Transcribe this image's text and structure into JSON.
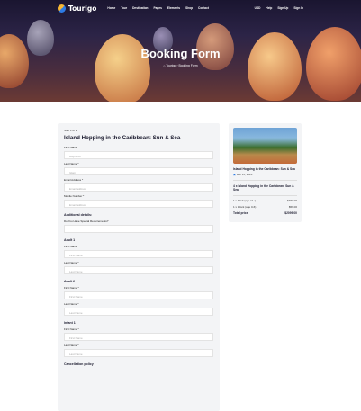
{
  "brand": {
    "name": "Tourigo"
  },
  "nav": {
    "items": [
      "Home",
      "Tour",
      "Destination",
      "Pages",
      "Elements",
      "Shop",
      "Contact"
    ],
    "right": [
      "USD",
      "Help",
      "Sign Up",
      "Sign In"
    ]
  },
  "hero": {
    "title": "Booking Form",
    "breadcrumb_home": "Tourigo",
    "breadcrumb_current": "Booking Form"
  },
  "form": {
    "step": "Step 1 of 2",
    "title": "Island Hopping in the Caribbean: Sun & Sea",
    "first_name_label": "First Name *",
    "first_name_value": "Rayhanur",
    "last_name_label": "Last Name *",
    "last_name_value": "Islam",
    "email_label": "Email Address *",
    "email_placeholder": "Email address",
    "phone_label": "Mobile Number *",
    "phone_placeholder": "Email address",
    "additional_heading": "Additional details:",
    "special_req_label": "Do You Have Special Requirements?",
    "adult1_heading": "Adult 1",
    "adult1_first_label": "First Name *",
    "adult1_first_placeholder": "First Name",
    "adult1_last_label": "Last Name *",
    "adult1_last_placeholder": "Last Name",
    "adult2_heading": "Adult 2",
    "adult2_first_label": "First Name *",
    "adult2_first_placeholder": "First Name",
    "adult2_last_label": "Last Name *",
    "adult2_last_placeholder": "Last Name",
    "infant1_heading": "Infant 1",
    "infant1_first_label": "First Name *",
    "infant1_first_placeholder": "First Name",
    "infant1_last_label": "Last Name *",
    "infant1_last_placeholder": "Last Name",
    "cancel_heading": "Cancellation policy"
  },
  "summary": {
    "tour_name": "Island Hopping in the Caribbean: Sun & Sea",
    "date": "Mar 15, 2024",
    "package": "4 x Island Hopping in the Caribbean: Sun & Sea",
    "rows": [
      {
        "label": "1 x Adult (age 11+)",
        "value": "$450.00"
      },
      {
        "label": "1 x Infant (age 0-6)",
        "value": "$59.00"
      }
    ],
    "total_label": "Total price",
    "total_value": "$2099.00"
  }
}
